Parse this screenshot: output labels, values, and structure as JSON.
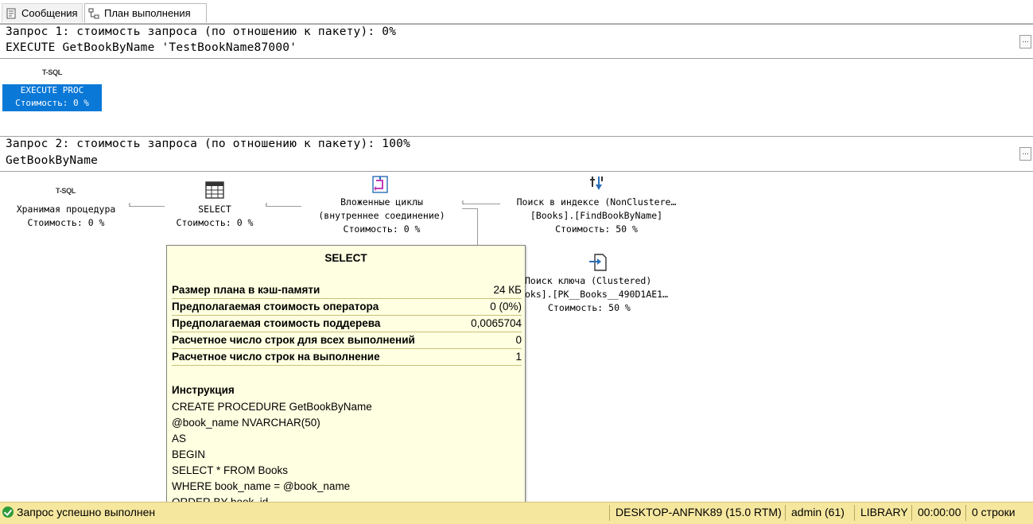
{
  "tabs": [
    {
      "label": "Сообщения",
      "icon": "messages-icon"
    },
    {
      "label": "План выполнения",
      "icon": "execution-plan-icon"
    }
  ],
  "query1": {
    "line1": "Запрос 1: стоимость запроса (по отношению к пакету): 0%",
    "line2": "EXECUTE GetBookByName 'TestBookName87000'",
    "button": "...",
    "node": {
      "badge": "T-SQL",
      "label": "EXECUTE PROC",
      "cost": "Стоимость: 0 %"
    }
  },
  "query2": {
    "line1": "Запрос 2: стоимость запроса (по отношению к пакету): 100%",
    "line2": "GetBookByName",
    "button": "...",
    "nodes": {
      "proc": {
        "badge": "T-SQL",
        "label": "Хранимая процедура",
        "cost": "Стоимость: 0 %"
      },
      "select": {
        "label": "SELECT",
        "cost": "Стоимость: 0 %",
        "icon": "select-icon"
      },
      "nested_loops": {
        "label1": "Вложенные циклы",
        "label2": "(внутреннее соединение)",
        "cost": "Стоимость: 0 %",
        "icon": "nested-loops-icon"
      },
      "index_seek": {
        "label1": "Поиск в индексе (NonClustere…",
        "label2": "[Books].[FindBookByName]",
        "cost": "Стоимость: 50 %",
        "icon": "index-seek-icon"
      },
      "key_lookup": {
        "label1": "Поиск ключа (Clustered)",
        "label2": "oks].[PK__Books__490D1AE1…",
        "cost": "Стоимость: 50 %",
        "icon": "key-lookup-icon"
      }
    }
  },
  "tooltip": {
    "title": "SELECT",
    "rows": [
      {
        "k": "Размер плана в кэш-памяти",
        "v": "24 КБ"
      },
      {
        "k": "Предполагаемая стоимость оператора",
        "v": "0 (0%)"
      },
      {
        "k": "Предполагаемая стоимость поддерева",
        "v": "0,0065704"
      },
      {
        "k": "Расчетное число строк для всех выполнений",
        "v": "0"
      },
      {
        "k": "Расчетное число строк на выполнение",
        "v": "1"
      }
    ],
    "statement_header": "Инструкция",
    "statement": [
      "CREATE PROCEDURE GetBookByName",
      "@book_name NVARCHAR(50)",
      "AS",
      "BEGIN",
      "SELECT * FROM Books",
      "WHERE book_name = @book_name",
      "ORDER BY book_id"
    ]
  },
  "status": {
    "message": "Запрос успешно выполнен",
    "server": "DESKTOP-ANFNK89 (15.0 RTM)",
    "user": "admin (61)",
    "database": "LIBRARY",
    "time": "00:00:00",
    "rows": "0 строки"
  }
}
